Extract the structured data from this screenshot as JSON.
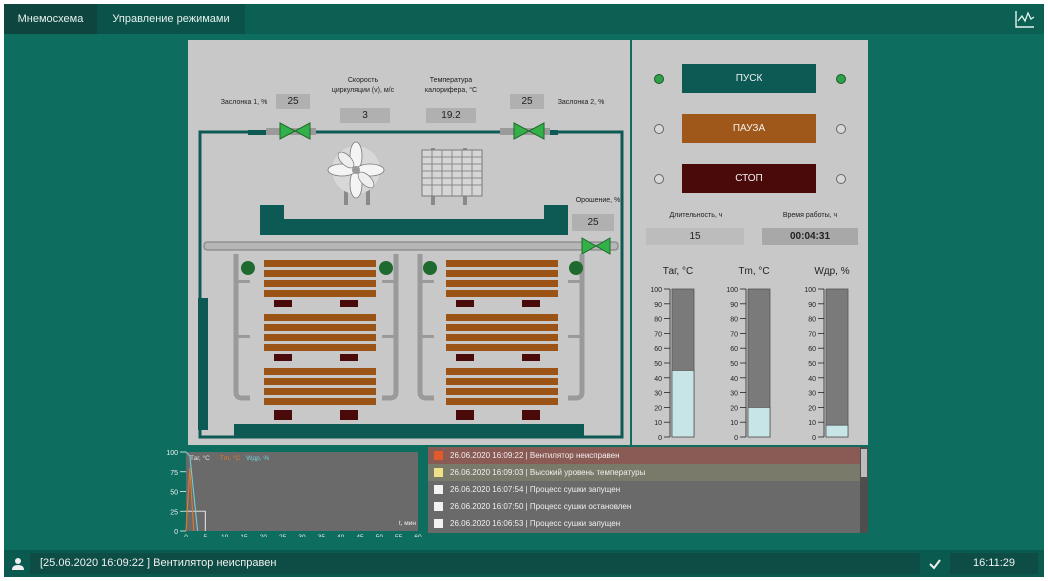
{
  "tabs": [
    {
      "label": "Мнемосхема"
    },
    {
      "label": "Управление режимами"
    }
  ],
  "scheme": {
    "damper1": {
      "label": "Заслонка 1, %",
      "value": "25"
    },
    "speed": {
      "label_line1": "Скорость",
      "label_line2": "циркуляции (v), м/с",
      "value": "3"
    },
    "temp": {
      "label_line1": "Температура",
      "label_line2": "калорифера, °С",
      "value": "19.2"
    },
    "damper2": {
      "label": "Заслонка 2, %",
      "value": "25"
    },
    "irrigation": {
      "label": "Орошение, %",
      "value": "25"
    }
  },
  "controls": {
    "start_label": "ПУСК",
    "pause_label": "ПАУЗА",
    "stop_label": "СТОП",
    "duration_label": "Длительность, ч",
    "duration_value": "15",
    "runtime_label": "Время работы, ч",
    "runtime_value": "00:04:31"
  },
  "gauges": [
    {
      "title": "Таг, °С",
      "value": 45,
      "ticks": [
        "100",
        "90",
        "80",
        "70",
        "60",
        "50",
        "40",
        "30",
        "20",
        "10",
        "0"
      ]
    },
    {
      "title": "Тm, °С",
      "value": 20,
      "ticks": [
        "100",
        "90",
        "80",
        "70",
        "60",
        "50",
        "40",
        "30",
        "20",
        "10",
        "0"
      ]
    },
    {
      "title": "Wдр, %",
      "value": 8,
      "ticks": [
        "100",
        "90",
        "80",
        "70",
        "60",
        "50",
        "40",
        "30",
        "20",
        "10",
        "0"
      ]
    }
  ],
  "chart_data": {
    "type": "line",
    "legend": [
      "Таг, °С",
      "Тm, °С",
      "Wдр, %"
    ],
    "legend_colors": [
      "#e0e0e0",
      "#e07a2a",
      "#6fd0d8"
    ],
    "xlabel": "t, мин",
    "xlim": [
      0,
      60
    ],
    "ylim": [
      0,
      100
    ],
    "x_ticks": [
      "0",
      "5",
      "10",
      "15",
      "20",
      "25",
      "30",
      "35",
      "40",
      "45",
      "50",
      "55",
      "60"
    ],
    "y_ticks": [
      "100",
      "75",
      "50",
      "25",
      "0"
    ],
    "series": [
      {
        "name": "Таг, °С",
        "color": "#e0e0e0",
        "x": [
          0,
          1,
          5,
          5
        ],
        "y": [
          25,
          25,
          25,
          0
        ]
      },
      {
        "name": "Тm, °С",
        "color": "#e07a2a",
        "x": [
          0,
          1,
          2
        ],
        "y": [
          0,
          80,
          0
        ]
      },
      {
        "name": "Wдр, %",
        "color": "#6fd0d8",
        "x": [
          0,
          1,
          3
        ],
        "y": [
          100,
          95,
          0
        ]
      }
    ]
  },
  "alarms": [
    {
      "text": "26.06.2020  16:09:22 | Вентилятор неисправен",
      "row_color": "#8a5a55",
      "sq_color": "#e05a2a"
    },
    {
      "text": "26.06.2020  16:09:03 | Высокий уровень температуры",
      "row_color": "#7a7a6a",
      "sq_color": "#f0e08a"
    },
    {
      "text": "26.06.2020  16:07:54 | Процесс сушки запущен",
      "row_color": "#6a6a6a",
      "sq_color": "#f2f2f2"
    },
    {
      "text": "26.06.2020  16:07:50 | Процесс сушки остановлен",
      "row_color": "#6a6a6a",
      "sq_color": "#f2f2f2"
    },
    {
      "text": "26.06.2020  16:06:53 | Процесс сушки запущен",
      "row_color": "#6a6a6a",
      "sq_color": "#f2f2f2"
    }
  ],
  "status": {
    "message": "[25.06.2020  16:09:22 ]  Вентилятор неисправен",
    "time": "16:11:29"
  },
  "icons": {
    "user": "user-icon",
    "check": "check-icon",
    "chart": "chart-icon"
  }
}
